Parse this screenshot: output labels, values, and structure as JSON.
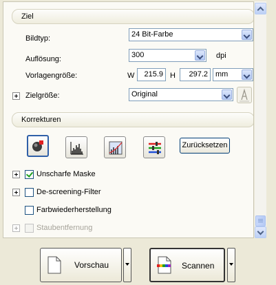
{
  "ziel_group": {
    "title": "Ziel",
    "bildtyp_label": "Bildtyp:",
    "bildtyp_value": "24 Bit-Farbe",
    "aufloesung_label": "Auflösung:",
    "aufloesung_value": "300",
    "aufloesung_unit": "dpi",
    "vorlagengroesse_label": "Vorlagengröße:",
    "w_label": "W",
    "w_value": "215.9",
    "h_label": "H",
    "h_value": "297.2",
    "unit_value": "mm",
    "zielgroesse_label": "Zielgröße:",
    "zielgroesse_value": "Original"
  },
  "korrekturen_group": {
    "title": "Korrekturen",
    "reset_label": "Zurücksetzen",
    "options": [
      {
        "label": "Unscharfe Maske",
        "checked": true
      },
      {
        "label": "De-screening-Filter",
        "checked": false
      },
      {
        "label": "Farbwiederherstellung",
        "checked": false
      },
      {
        "label": "Staubentfernung",
        "checked": false,
        "disabled": true
      }
    ]
  },
  "bottom": {
    "preview_label": "Vorschau",
    "scan_label": "Scannen"
  },
  "icons": {
    "auto_exposure": "auto-exposure-icon",
    "histogram": "histogram-icon",
    "tone_curve": "tone-curve-icon",
    "image_adjust": "image-adjustment-icon",
    "lock": "lock-icon",
    "preview": "preview-document-icon",
    "scan": "scan-document-icon"
  }
}
